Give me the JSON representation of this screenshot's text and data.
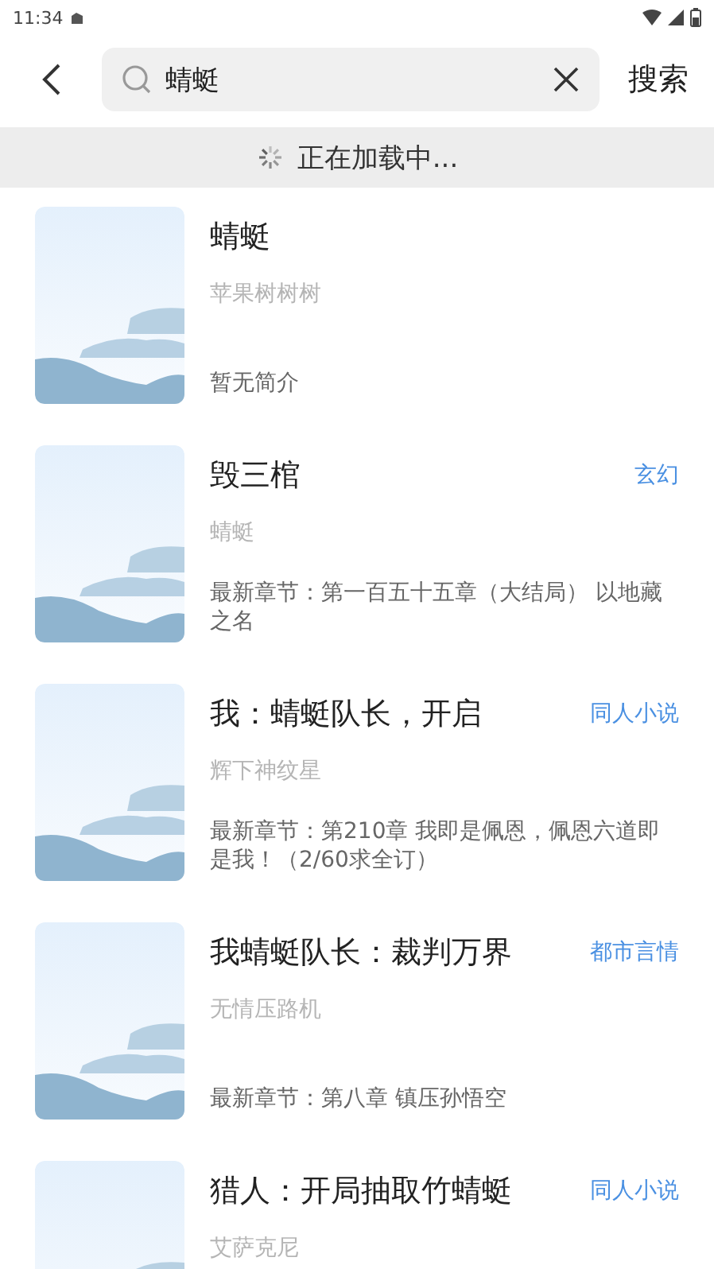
{
  "status_bar": {
    "time": "11:34"
  },
  "search": {
    "value": "蜻蜓",
    "button": "搜索"
  },
  "loading": {
    "text": "正在加载中..."
  },
  "books": [
    {
      "title": "蜻蜓",
      "author": "苹果树树树",
      "intro": "暂无简介"
    },
    {
      "title": "毁三棺",
      "category": "玄幻",
      "author": "蜻蜓",
      "intro": "最新章节：第一百五十五章（大结局） 以地藏之名"
    },
    {
      "title": "我：蜻蜓队长，开启",
      "category": "同人小说",
      "author": "辉下神纹星",
      "intro": "最新章节：第210章 我即是佩恩，佩恩六道即是我！（2/60求全订）"
    },
    {
      "title": "我蜻蜓队长：裁判万界",
      "category": "都市言情",
      "author": "无情压路机",
      "intro": "最新章节：第八章 镇压孙悟空"
    },
    {
      "title": "猎人：开局抽取竹蜻蜓",
      "category": "同人小说",
      "author": "艾萨克尼"
    }
  ]
}
